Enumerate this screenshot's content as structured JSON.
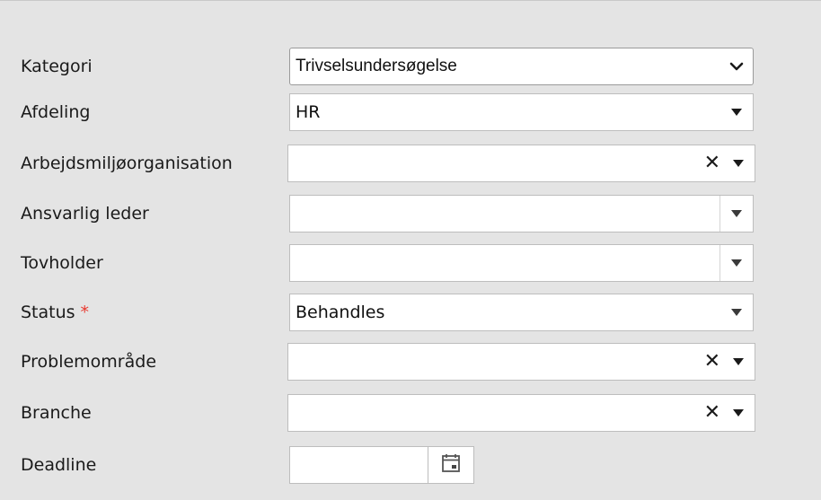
{
  "form": {
    "kategori": {
      "label": "Kategori",
      "value": "Trivselsundersøgelse",
      "icon": "chevron-down-icon"
    },
    "afdeling": {
      "label": "Afdeling",
      "value": "HR",
      "icon": "caret-down-icon"
    },
    "arbejdsmiljo": {
      "label": "Arbejdsmiljøorganisation",
      "value": "",
      "clear_icon": "✕",
      "icon": "caret-down-icon"
    },
    "ansvarlig": {
      "label": "Ansvarlig leder",
      "value": "",
      "icon": "caret-down-icon"
    },
    "tovholder": {
      "label": "Tovholder",
      "value": "",
      "icon": "caret-down-icon"
    },
    "status": {
      "label": "Status",
      "required_mark": "*",
      "value": "Behandles",
      "icon": "caret-down-icon"
    },
    "problemomrade": {
      "label": "Problemområde",
      "value": "",
      "clear_icon": "✕",
      "icon": "caret-down-icon"
    },
    "branche": {
      "label": "Branche",
      "value": "",
      "clear_icon": "✕",
      "icon": "caret-down-icon"
    },
    "deadline": {
      "label": "Deadline",
      "value": "",
      "icon": "calendar-icon"
    }
  },
  "colors": {
    "panel_bg": "#e4e4e4",
    "required": "#e8392f",
    "field_border": "#bdbdbd"
  }
}
